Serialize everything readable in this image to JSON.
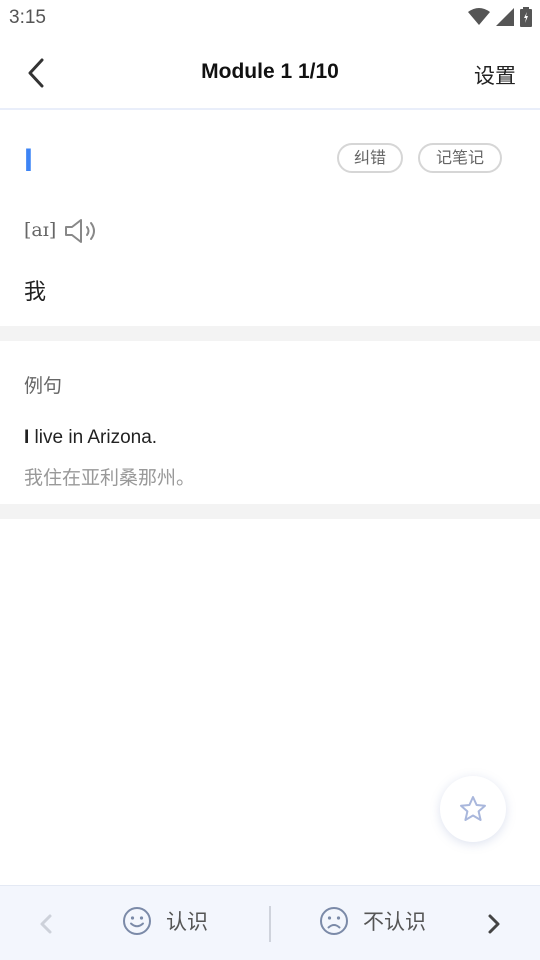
{
  "status": {
    "time": "3:15"
  },
  "header": {
    "title": "Module 1 1/10",
    "settings_label": "设置"
  },
  "word": {
    "text": "I",
    "phonetic": "[aɪ]",
    "meaning": "我",
    "chips": {
      "correct": "纠错",
      "note": "记笔记"
    }
  },
  "examples": {
    "heading": "例句",
    "sentence_bold": "I",
    "sentence_rest": " live in Arizona.",
    "translation": "我住在亚利桑那州。"
  },
  "bottom": {
    "know_label": "认识",
    "unknow_label": "不认识"
  },
  "colors": {
    "accent": "#3d84f5",
    "bar_bg": "#f3f6fd"
  },
  "icons": [
    "back-arrow-icon",
    "speaker-icon",
    "star-icon",
    "smile-icon",
    "frown-icon",
    "prev-icon",
    "next-icon",
    "wifi-icon",
    "signal-icon",
    "battery-icon"
  ]
}
